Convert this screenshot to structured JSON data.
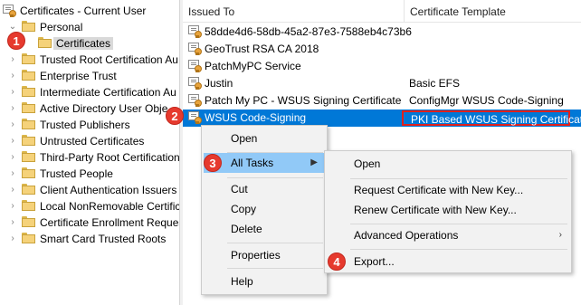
{
  "tree": {
    "items": [
      {
        "label": "Certificates - Current User",
        "level": 0,
        "expanded": true
      },
      {
        "label": "Personal",
        "level": 1,
        "expanded": true
      },
      {
        "label": "Certificates",
        "level": 2,
        "selected": true
      },
      {
        "label": "Trusted Root Certification Au",
        "level": 1
      },
      {
        "label": "Enterprise Trust",
        "level": 1
      },
      {
        "label": "Intermediate Certification Au",
        "level": 1
      },
      {
        "label": "Active Directory User Obje",
        "level": 1
      },
      {
        "label": "Trusted Publishers",
        "level": 1
      },
      {
        "label": "Untrusted Certificates",
        "level": 1
      },
      {
        "label": "Third-Party Root Certification",
        "level": 1
      },
      {
        "label": "Trusted People",
        "level": 1
      },
      {
        "label": "Client Authentication Issuers",
        "level": 1
      },
      {
        "label": "Local NonRemovable Certific",
        "level": 1
      },
      {
        "label": "Certificate Enrollment Reques",
        "level": 1
      },
      {
        "label": "Smart Card Trusted Roots",
        "level": 1
      }
    ]
  },
  "list": {
    "columns": [
      "Issued To",
      "Certificate Template"
    ],
    "rows": [
      {
        "issued_to": "58dde4d6-58db-45a2-87e3-7588eb4c73b6",
        "template": ""
      },
      {
        "issued_to": "GeoTrust RSA CA 2018",
        "template": ""
      },
      {
        "issued_to": "PatchMyPC Service",
        "template": ""
      },
      {
        "issued_to": "Justin",
        "template": "Basic EFS"
      },
      {
        "issued_to": "Patch My PC - WSUS Signing Certificate",
        "template": "ConfigMgr WSUS Code-Signing"
      },
      {
        "issued_to": "WSUS Code-Signing",
        "template": "PKI Based WSUS Signing Certificate",
        "selected": true
      }
    ]
  },
  "context_menu": {
    "open": "Open",
    "all_tasks": "All Tasks",
    "cut": "Cut",
    "copy": "Copy",
    "delete": "Delete",
    "properties": "Properties",
    "help": "Help"
  },
  "submenu": {
    "open": "Open",
    "request_new_key": "Request Certificate with New Key...",
    "renew_new_key": "Renew Certificate with New Key...",
    "advanced_operations": "Advanced Operations",
    "export": "Export..."
  },
  "steps": {
    "one": "1",
    "two": "2",
    "three": "3",
    "four": "4"
  },
  "icons": {
    "tree_root": "certificate-store-icon",
    "folder": "folder-icon",
    "cert": "certificate-icon",
    "expand": "chevron-right-icon",
    "collapse": "chevron-down-icon",
    "submenu": "chevron-right-icon"
  },
  "colors": {
    "selection": "#0078d7",
    "menu_highlight": "#91c9f7",
    "callout_red": "#e63a2e",
    "tree_selected": "#d9d9d9"
  }
}
